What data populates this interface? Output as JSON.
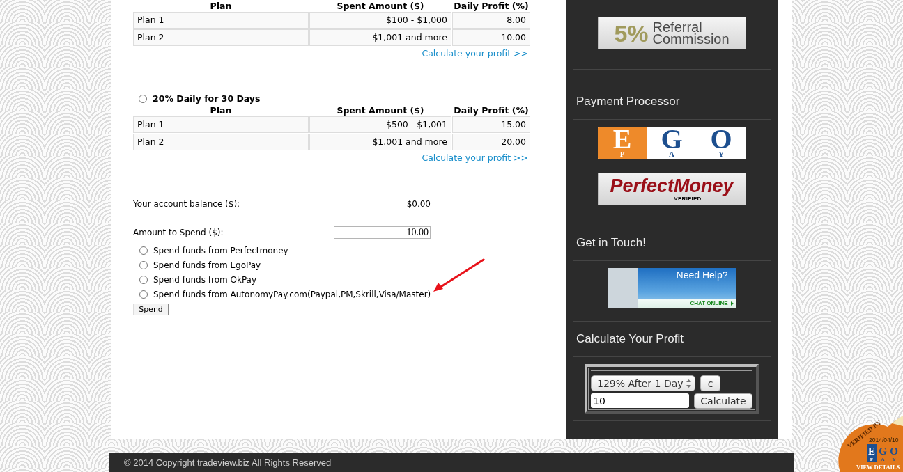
{
  "plan_tables": [
    {
      "columns": [
        "Plan",
        "Spent Amount ($)",
        "Daily Profit (%)"
      ],
      "rows": [
        [
          "Plan 1",
          "$100 - $1,000",
          "8.00"
        ],
        [
          "Plan 2",
          "$1,001 and more",
          "10.00"
        ]
      ],
      "link": "Calculate your profit >>"
    },
    {
      "title": {
        "label": "20% Daily for 30 Days",
        "selected": false
      },
      "columns": [
        "Plan",
        "Spent Amount ($)",
        "Daily Profit (%)"
      ],
      "rows": [
        [
          "Plan 1",
          "$500 - $1,001",
          "15.00"
        ],
        [
          "Plan 2",
          "$1,001 and more",
          "20.00"
        ]
      ],
      "link": "Calculate your profit >>"
    }
  ],
  "balance": {
    "label": "Your account balance ($):",
    "value": "$0.00"
  },
  "amount": {
    "label": "Amount to Spend ($):",
    "value": "10.00"
  },
  "payment_options": [
    {
      "label": "Spend funds from Perfectmoney",
      "selected": false
    },
    {
      "label": "Spend funds from EgoPay",
      "selected": false
    },
    {
      "label": "Spend funds from OkPay",
      "selected": false
    },
    {
      "label": "Spend funds from AutonomyPay.com(Paypal,PM,Skrill,Visa/Master)",
      "selected": false
    }
  ],
  "spend_button": "Spend",
  "sidebar": [
    {
      "blocks": [
        {
          "kind": "referral",
          "percent": "5%",
          "lines": [
            "Referral",
            "Commission"
          ]
        }
      ]
    },
    {
      "heading": "Payment Processor",
      "blocks": [
        {
          "kind": "egopay",
          "letters": [
            {
              "top": "E",
              "bottom": "P"
            },
            {
              "top": "G",
              "bottom": "A"
            },
            {
              "top": "O",
              "bottom": "Y"
            }
          ]
        },
        {
          "kind": "perfectmoney",
          "name": "PerfectMoney",
          "badge": "VERIFIED"
        }
      ]
    },
    {
      "heading": "Get in Touch!",
      "blocks": [
        {
          "kind": "chat",
          "title": "Need Help?",
          "action": "CHAT ONLINE"
        }
      ]
    },
    {
      "heading": "Calculate Your Profit",
      "blocks": [
        {
          "kind": "calculator",
          "plan": "129% After 1 Day",
          "clear_button": "c",
          "amount": "10",
          "submit_button": "Calculate"
        }
      ]
    }
  ],
  "footer": "© 2014 Copyright tradeview.biz All Rights Reserved",
  "verified_badge": {
    "caption": "VERIFIED BY",
    "date": "2014/04/10",
    "logo_letters": [
      {
        "top": "E",
        "bottom": "P"
      },
      {
        "top": "G",
        "bottom": "A"
      },
      {
        "top": "O",
        "bottom": "Y"
      }
    ],
    "link": "VIEW DETAILS"
  }
}
